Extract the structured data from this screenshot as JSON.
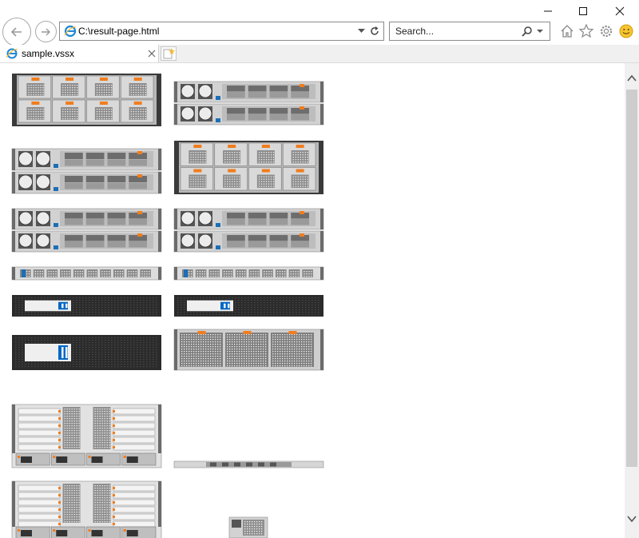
{
  "window": {
    "minimize_icon": "minimize-icon",
    "maximize_icon": "maximize-icon",
    "close_icon": "close-icon"
  },
  "toolbar": {
    "address": "C:\\result-page.html",
    "search_placeholder": "Search...",
    "icons": [
      "back-icon",
      "forward-icon",
      "ie-logo-icon",
      "dropdown-icon",
      "refresh-icon",
      "search-icon",
      "home-icon",
      "favorites-star-icon",
      "settings-gear-icon",
      "feedback-smiley-icon"
    ]
  },
  "tabs": [
    {
      "label": "sample.vssx"
    }
  ],
  "colors": {
    "accent_orange": "#f07d1e",
    "accent_blue": "#1c6fb6",
    "netapp_blue": "#0067c5",
    "rack_dark": "#2b2b2b",
    "rack_silver": "#c9c9c9"
  }
}
